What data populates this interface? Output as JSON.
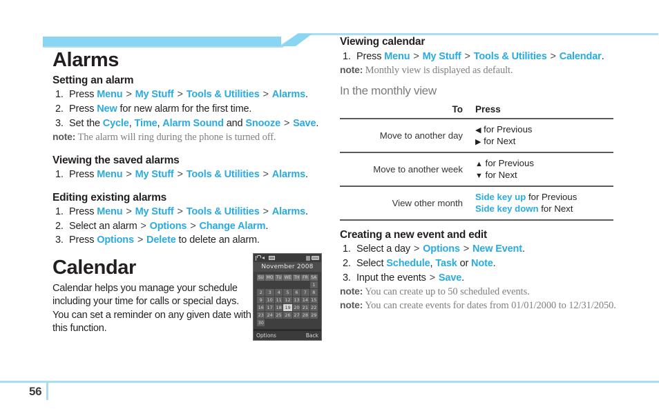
{
  "page": {
    "number": "56",
    "accent_color": "#29abe2",
    "rule_color": "#a8ddf2"
  },
  "left_column": {
    "chapter_title": "Alarms",
    "sections": [
      {
        "heading": "Setting an alarm",
        "steps": [
          {
            "num": "1.",
            "text": "Press Menu > My Stuff > Tools & Utilities > Alarms."
          },
          {
            "num": "2.",
            "text": "Press New for new alarm for the first time."
          },
          {
            "num": "3.",
            "text": "Set the Cycle, Time, Alarm Sound and Snooze > Save."
          }
        ],
        "note_label": "note:",
        "note_text": "The alarm will ring during the phone is turned off."
      },
      {
        "heading": "Viewing the saved alarms",
        "steps": [
          {
            "num": "1.",
            "text": "Press Menu > My Stuff > Tools & Utilities > Alarms."
          }
        ]
      },
      {
        "heading": "Editing existing alarms",
        "steps": [
          {
            "num": "1.",
            "text": "Press Menu > My Stuff > Tools & Utilities > Alarms."
          },
          {
            "num": "2.",
            "text": "Select an alarm > Options > Change Alarm."
          },
          {
            "num": "3.",
            "text": "Press Options > Delete to delete an alarm."
          }
        ]
      }
    ],
    "calendar": {
      "chapter_title": "Calendar",
      "body": "Calendar helps you manage your schedule including your time for calls or special days. You can set a reminder on any given date with this function."
    }
  },
  "phone_screenshot": {
    "status_icons": [
      "signal-icon",
      "mute-icon",
      "mail-icon",
      "bluetooth-icon",
      "battery-icon"
    ],
    "month_title": "November 2008",
    "weekday_headers": [
      "SU",
      "MO",
      "TU",
      "WE",
      "TH",
      "FR",
      "SA"
    ],
    "weeks": [
      [
        "",
        "",
        "",
        "",
        "",
        "",
        "1"
      ],
      [
        "2",
        "3",
        "4",
        "5",
        "6",
        "7",
        "8"
      ],
      [
        "9",
        "10",
        "11",
        "12",
        "13",
        "14",
        "15"
      ],
      [
        "16",
        "17",
        "18",
        "19",
        "20",
        "21",
        "22"
      ],
      [
        "23",
        "24",
        "25",
        "26",
        "27",
        "28",
        "29"
      ],
      [
        "30",
        "",
        "",
        "",
        "",
        "",
        ""
      ]
    ],
    "selected_day": "19",
    "softkey_left": "Options",
    "softkey_right": "Back"
  },
  "right_column": {
    "sections": [
      {
        "heading": "Viewing calendar",
        "steps": [
          {
            "num": "1.",
            "text": "Press Menu > My Stuff > Tools & Utilities > Calendar."
          }
        ],
        "note_label": "note:",
        "note_text": "Monthly view is displayed as default."
      }
    ],
    "monthly_view_heading": "In the monthly view",
    "key_table": {
      "headers": [
        "To",
        "Press"
      ],
      "rows": [
        {
          "to": "Move to another day",
          "press_lines": [
            {
              "glyph": "◀",
              "text": " for Previous",
              "highlight": ""
            },
            {
              "glyph": "▶",
              "text": " for Next",
              "highlight": ""
            }
          ]
        },
        {
          "to": "Move to another week",
          "press_lines": [
            {
              "glyph": "▲",
              "text": " for Previous",
              "highlight": ""
            },
            {
              "glyph": "▼",
              "text": " for Next",
              "highlight": ""
            }
          ]
        },
        {
          "to": "View other month",
          "press_lines": [
            {
              "glyph": "",
              "text": " for Previous",
              "highlight": "Side key up"
            },
            {
              "glyph": "",
              "text": " for Next",
              "highlight": "Side key down"
            }
          ]
        }
      ]
    },
    "creating": {
      "heading": "Creating a new event and edit",
      "steps": [
        {
          "num": "1.",
          "text": "Select a day > Options > New Event."
        },
        {
          "num": "2.",
          "text": "Select Schedule, Task or Note."
        },
        {
          "num": "3.",
          "text": "Input the events > Save."
        }
      ],
      "notes": [
        {
          "label": "note:",
          "text": "You can create up to 50 scheduled events."
        },
        {
          "label": "note:",
          "text": "You can create events for dates from 01/01/2000 to 12/31/2050."
        }
      ]
    }
  },
  "keyword_map": [
    "Menu",
    "My Stuff",
    "Tools & Utilities",
    "Alarms",
    "New",
    "Cycle",
    "Time",
    "Alarm Sound",
    "Snooze",
    "Save",
    "Options",
    "Change Alarm",
    "Delete",
    "Calendar",
    "New Event",
    "Schedule",
    "Task",
    "Note"
  ]
}
